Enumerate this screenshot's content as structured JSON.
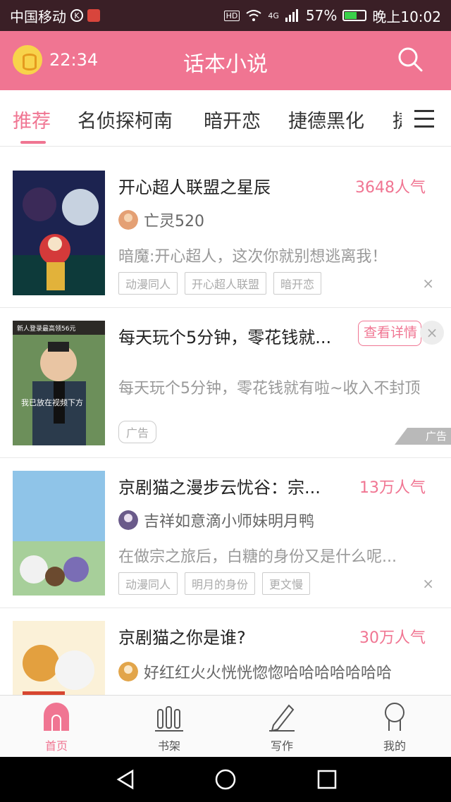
{
  "status_bar": {
    "carrier": "中国移动",
    "signal_type": "4G",
    "battery": "57%",
    "time": "晚上10:02"
  },
  "app_bar": {
    "timer": "22:34",
    "title": "话本小说"
  },
  "tabs": [
    {
      "label": "推荐",
      "active": true
    },
    {
      "label": "名侦探柯南"
    },
    {
      "label": "暗开恋"
    },
    {
      "label": "捷德黑化"
    },
    {
      "label": "捷德"
    }
  ],
  "feed": [
    {
      "title": "开心超人联盟之星辰",
      "popularity": "3648人气",
      "author": "亡灵520",
      "description": "暗魔:开心超人，这次你就别想逃离我！",
      "tags": [
        "动漫同人",
        "开心超人联盟",
        "暗开恋"
      ],
      "close": "×"
    },
    {
      "title": "每天玩个5分钟，零花钱就...",
      "action": "查看详情",
      "description": "每天玩个5分钟，零花钱就有啦~收入不封顶",
      "tag": "广告",
      "ad_mark": "广告",
      "cover_banner": "新人登录最高领56元",
      "cover_caption": "我已放在视频下方",
      "close": "×"
    },
    {
      "title": "京剧猫之漫步云忧谷：宗...",
      "popularity": "13万人气",
      "author": "吉祥如意滴小师妹明月鸭",
      "description": "在做宗之旅后，白糖的身份又是什么呢...",
      "tags": [
        "动漫同人",
        "明月的身份",
        "更文慢"
      ],
      "close": "×"
    },
    {
      "title": "京剧猫之你是谁?",
      "popularity": "30万人气",
      "author": "好红红火火恍恍惚惚哈哈哈哈哈哈哈"
    }
  ],
  "bottom_nav": [
    {
      "label": "首页",
      "icon": "home-icon",
      "active": true
    },
    {
      "label": "书架",
      "icon": "bookshelf-icon"
    },
    {
      "label": "写作",
      "icon": "pen-icon"
    },
    {
      "label": "我的",
      "icon": "profile-icon"
    }
  ],
  "colors": {
    "accent": "#f07592",
    "status_bar": "#3a1f26"
  }
}
